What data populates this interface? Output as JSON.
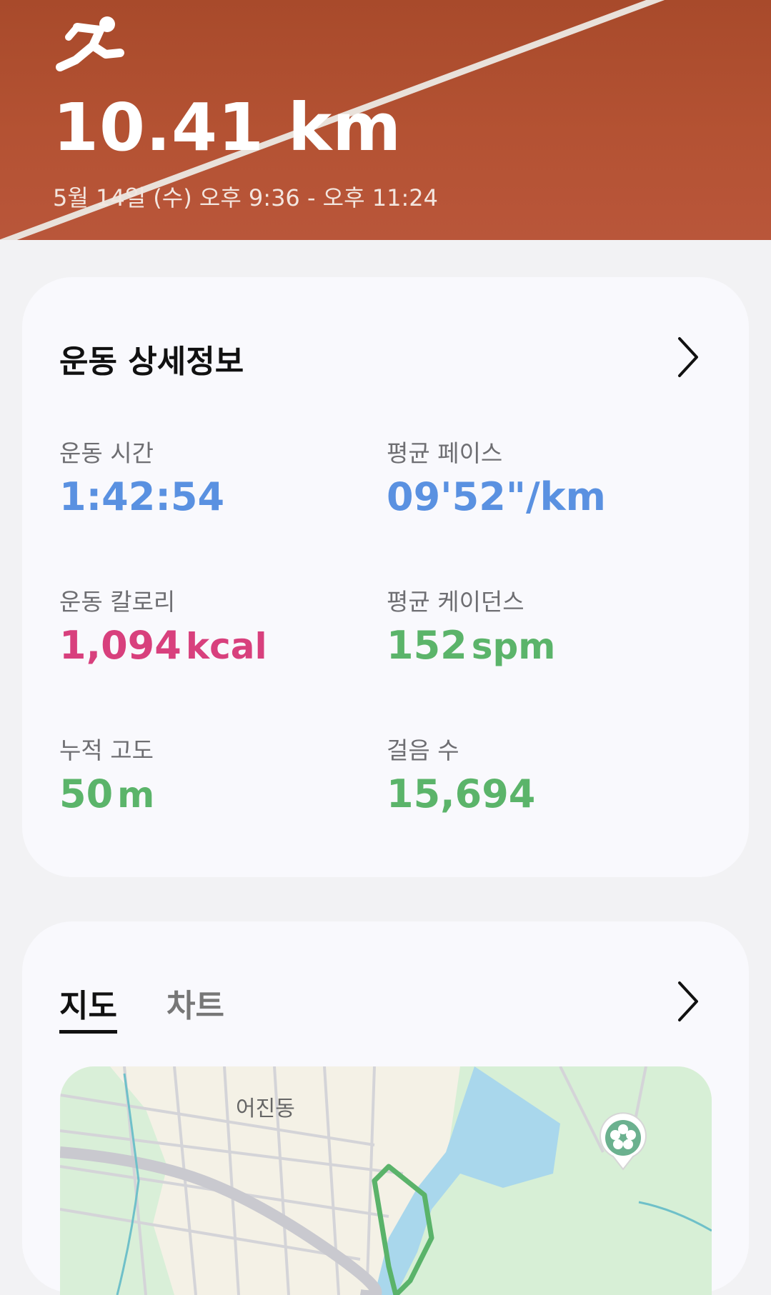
{
  "header": {
    "icon": "running-person-icon",
    "distance": "10.41 km",
    "date_range": "5월 14일 (수) 오후 9:36 - 오후 11:24"
  },
  "details_card": {
    "title": "운동 상세정보",
    "chevron_icon": "chevron-right-icon",
    "stats": {
      "time": {
        "label": "운동 시간",
        "value": "1:42:54"
      },
      "pace": {
        "label": "평균 페이스",
        "value": "09'52\"/km"
      },
      "calories": {
        "label": "운동 칼로리",
        "value": "1,094",
        "unit": "kcal"
      },
      "cadence": {
        "label": "평균 케이던스",
        "value": "152",
        "unit": "spm"
      },
      "elevation": {
        "label": "누적 고도",
        "value": "50",
        "unit": "m"
      },
      "steps": {
        "label": "걸음 수",
        "value": "15,694"
      }
    }
  },
  "map_card": {
    "tabs": [
      "지도",
      "차트"
    ],
    "active_tab": "지도",
    "chevron_icon": "chevron-right-icon",
    "map_label": "어진동",
    "marker_icon": "flower-marker-icon"
  },
  "colors": {
    "blue": "#5a91e1",
    "pink": "#d8407d",
    "green": "#5bb46a",
    "track": "#b0512f"
  }
}
